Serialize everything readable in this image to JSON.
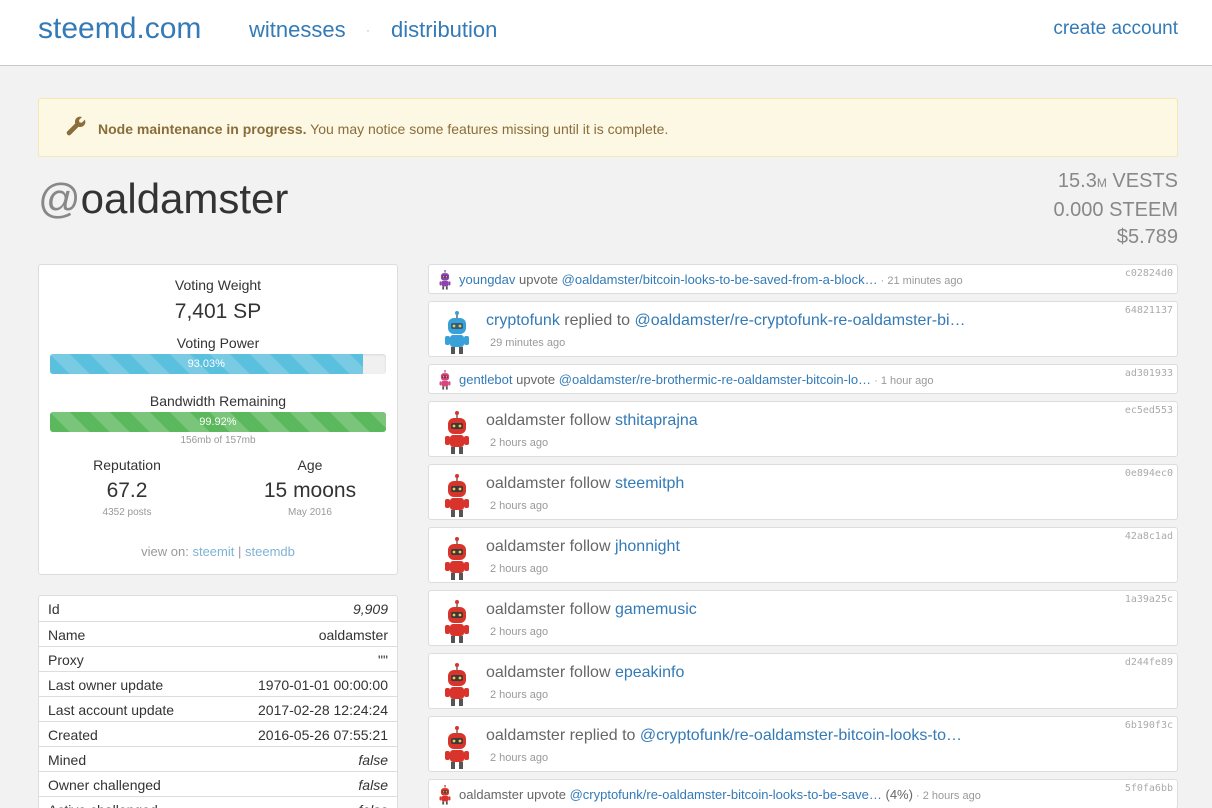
{
  "nav": {
    "brand": "steemd.com",
    "witnesses": "witnesses",
    "separator": "·",
    "distribution": "distribution",
    "create_account": "create account"
  },
  "alert": {
    "bold": "Node maintenance in progress.",
    "text": " You may notice some features missing until it is complete."
  },
  "profile": {
    "at": "@",
    "name": "oaldamster",
    "vests_value": "15.3",
    "vests_unit_small": "M",
    "vests_unit": " VESTS",
    "steem": "0.000 STEEM",
    "usd": "$5.789"
  },
  "voting": {
    "weight_label": "Voting Weight",
    "weight_value": "7,401 SP",
    "power_label": "Voting Power",
    "power_text": "93.03%",
    "power_fraction": 0.9303,
    "bandwidth_label": "Bandwidth Remaining",
    "bandwidth_text": "99.92%",
    "bandwidth_fraction": 0.9992,
    "bandwidth_sub": "156mb of 157mb",
    "reputation_label": "Reputation",
    "reputation_value": "67.2",
    "reputation_sub": "4352 posts",
    "age_label": "Age",
    "age_value": "15 moons",
    "age_sub": "May 2016",
    "view_on": "view on:",
    "view_steemit": "steemit",
    "view_sep": "|",
    "view_steemdb": "steemdb"
  },
  "info_rows": [
    {
      "key": "Id",
      "value": "9,909",
      "italic": true
    },
    {
      "key": "Name",
      "value": "oaldamster",
      "italic": false
    },
    {
      "key": "Proxy",
      "value": "\"\"",
      "italic": false
    },
    {
      "key": "Last owner update",
      "value": "1970-01-01 00:00:00",
      "italic": false
    },
    {
      "key": "Last account update",
      "value": "2017-02-28 12:24:24",
      "italic": false
    },
    {
      "key": "Created",
      "value": "2016-05-26 07:55:21",
      "italic": false
    },
    {
      "key": "Mined",
      "value": "false",
      "italic": true
    },
    {
      "key": "Owner challenged",
      "value": "false",
      "italic": true
    },
    {
      "key": "Active challenged",
      "value": "false",
      "italic": true
    }
  ],
  "activity": [
    {
      "kind": "small",
      "avatar": "purple-robot-icon",
      "actor": "youngdav",
      "verb": " upvote ",
      "target": "@oaldamster/bitcoin-looks-to-be-saved-from-a-block…",
      "extra": "",
      "time": "21 minutes ago",
      "hash": "c02824d0"
    },
    {
      "kind": "big",
      "avatar": "blue-robot-icon",
      "actor": "cryptofunk",
      "verb": " replied to ",
      "target": "@oaldamster/re-cryptofunk-re-oaldamster-bi…",
      "extra": "",
      "time": "29 minutes ago",
      "hash": "64821137"
    },
    {
      "kind": "small",
      "avatar": "pink-robot-icon",
      "actor": "gentlebot",
      "verb": " upvote ",
      "target": "@oaldamster/re-brothermic-re-oaldamster-bitcoin-lo…",
      "extra": "",
      "time": "1 hour ago",
      "hash": "ad301933"
    },
    {
      "kind": "big",
      "avatar": "red-robot-icon",
      "actor": "oaldamster",
      "verb": " follow ",
      "target": "sthitaprajna",
      "extra": "",
      "time": "2 hours ago",
      "hash": "ec5ed553"
    },
    {
      "kind": "big",
      "avatar": "red-robot-icon",
      "actor": "oaldamster",
      "verb": " follow ",
      "target": "steemitph",
      "extra": "",
      "time": "2 hours ago",
      "hash": "0e894ec0"
    },
    {
      "kind": "big",
      "avatar": "red-robot-icon",
      "actor": "oaldamster",
      "verb": " follow ",
      "target": "jhonnight",
      "extra": "",
      "time": "2 hours ago",
      "hash": "42a8c1ad"
    },
    {
      "kind": "big",
      "avatar": "red-robot-icon",
      "actor": "oaldamster",
      "verb": " follow ",
      "target": "gamemusic",
      "extra": "",
      "time": "2 hours ago",
      "hash": "1a39a25c"
    },
    {
      "kind": "big",
      "avatar": "red-robot-icon",
      "actor": "oaldamster",
      "verb": " follow ",
      "target": "epeakinfo",
      "extra": "",
      "time": "2 hours ago",
      "hash": "d244fe89"
    },
    {
      "kind": "big",
      "avatar": "red-robot-icon",
      "actor": "oaldamster",
      "verb": " replied to ",
      "target": "@cryptofunk/re-oaldamster-bitcoin-looks-to…",
      "extra": "",
      "time": "2 hours ago",
      "hash": "6b190f3c"
    },
    {
      "kind": "small",
      "avatar": "red-robot-icon",
      "actor": "oaldamster",
      "verb": " upvote ",
      "target": "@cryptofunk/re-oaldamster-bitcoin-looks-to-be-save…",
      "extra": " (4%)",
      "time": "2 hours ago",
      "hash": "5f0fa6bb"
    }
  ]
}
